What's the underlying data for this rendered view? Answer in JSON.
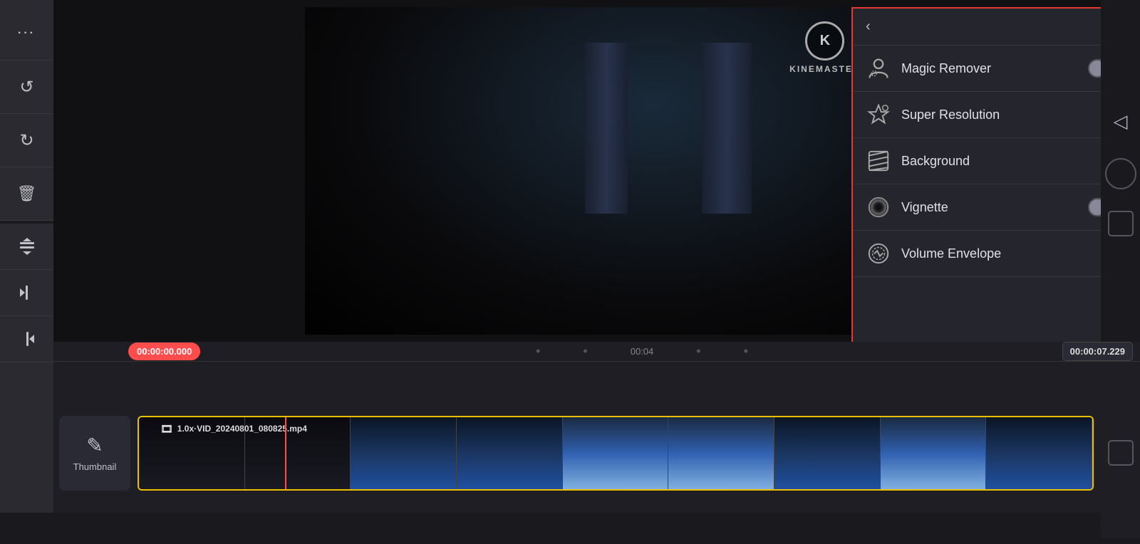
{
  "app": {
    "title": "KineMaster",
    "logo_letter": "K",
    "logo_name": "KINEMASTER"
  },
  "left_sidebar": {
    "buttons": [
      {
        "id": "more",
        "icon": "···",
        "label": "more-options"
      },
      {
        "id": "undo",
        "icon": "↺",
        "label": "undo"
      },
      {
        "id": "redo",
        "icon": "↻",
        "label": "redo"
      },
      {
        "id": "delete",
        "icon": "🗑",
        "label": "delete"
      }
    ],
    "lower_buttons": [
      {
        "id": "layer",
        "icon": "⊞",
        "label": "layer-options"
      },
      {
        "id": "trim-left",
        "icon": "◁|",
        "label": "trim-left"
      },
      {
        "id": "trim-right",
        "icon": "|▷",
        "label": "trim-right"
      }
    ]
  },
  "right_panel": {
    "back_label": "back",
    "items": [
      {
        "id": "magic-remover",
        "label": "Magic Remover",
        "control": "toggle",
        "toggle_state": "off",
        "icon_type": "person"
      },
      {
        "id": "super-resolution",
        "label": "Super Resolution",
        "control": "arrow",
        "icon_type": "superres"
      },
      {
        "id": "background",
        "label": "Background",
        "control": "arrow",
        "icon_type": "hatching"
      },
      {
        "id": "vignette",
        "label": "Vignette",
        "control": "toggle",
        "toggle_state": "off",
        "icon_type": "vignette"
      },
      {
        "id": "volume-envelope",
        "label": "Volume Envelope",
        "control": "arrow",
        "icon_type": "volume"
      }
    ]
  },
  "timeline": {
    "time_start": "00:00:00.000",
    "time_mid": "00:04",
    "time_end": "00:00:07.229",
    "track_filename": "1.0x·VID_20240801_080825.mp4",
    "thumbnail_label": "Thumbnail"
  },
  "right_edge": {
    "back_arrow": "◁",
    "circle": "○",
    "rect": "□"
  }
}
